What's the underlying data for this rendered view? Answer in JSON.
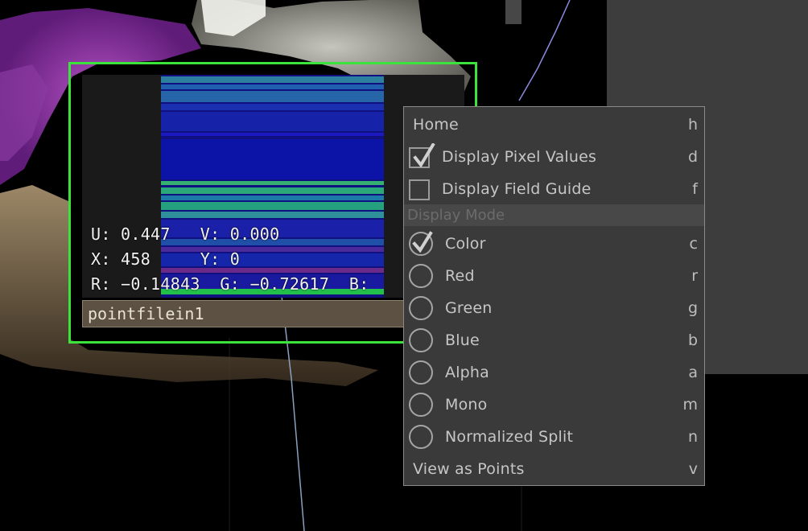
{
  "viewer": {
    "readout": {
      "u": "U: 0.447",
      "v": "V: 0.000",
      "x": "X: 458",
      "y": "Y: 0",
      "rgb": "R: −0.14843  G: −0.72617  B:"
    },
    "node_name": "pointfilein1"
  },
  "colors": {
    "node_border": "#3be33b",
    "menu_bg": "#3a3a3a",
    "panel_bg": "#3d3d3d"
  },
  "menu": {
    "home": {
      "label": "Home",
      "key": "h"
    },
    "display_pixel_values": {
      "label": "Display Pixel Values",
      "key": "d",
      "checked": true
    },
    "display_field_guide": {
      "label": "Display Field Guide",
      "key": "f",
      "checked": false
    },
    "section_title": "Display Mode",
    "modes": [
      {
        "label": "Color",
        "key": "c",
        "selected": true
      },
      {
        "label": "Red",
        "key": "r",
        "selected": false
      },
      {
        "label": "Green",
        "key": "g",
        "selected": false
      },
      {
        "label": "Blue",
        "key": "b",
        "selected": false
      },
      {
        "label": "Alpha",
        "key": "a",
        "selected": false
      },
      {
        "label": "Mono",
        "key": "m",
        "selected": false
      },
      {
        "label": "Normalized Split",
        "key": "n",
        "selected": false
      }
    ],
    "view_as_points": {
      "label": "View as Points",
      "key": "v"
    }
  }
}
